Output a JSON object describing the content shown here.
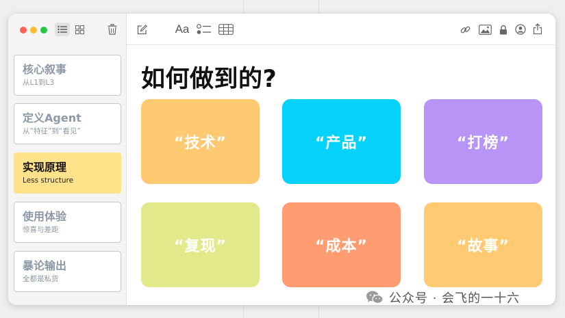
{
  "main": {
    "title": "如何做到的?",
    "cards": [
      {
        "label": "“技术”",
        "color": "#ffc972"
      },
      {
        "label": "“产品”",
        "color": "#04d2fb"
      },
      {
        "label": "“打榜”",
        "color": "#b794f6"
      },
      {
        "label": "“复现”",
        "color": "#e2e98a"
      },
      {
        "label": "“成本”",
        "color": "#ff9c72"
      },
      {
        "label": "“故事”",
        "color": "#ffca72"
      }
    ]
  },
  "sidebar": {
    "notes": [
      {
        "title": "核心叙事",
        "subtitle": "从L1到L3",
        "active": false
      },
      {
        "title": "定义Agent",
        "subtitle": "从“特征”到“看见”",
        "active": false
      },
      {
        "title": "实现原理",
        "subtitle": "Less structure",
        "active": true
      },
      {
        "title": "使用体验",
        "subtitle": "惊喜与差距",
        "active": false
      },
      {
        "title": "暴论输出",
        "subtitle": "全都是私货",
        "active": false
      }
    ]
  },
  "toolbar": {
    "font_label": "Aa",
    "icons": [
      "list-view-icon",
      "grid-view-icon",
      "trash-icon",
      "compose-icon",
      "format-icon",
      "checklist-icon",
      "table-icon",
      "link-icon",
      "image-icon",
      "lock-icon",
      "collaborate-icon",
      "share-icon"
    ]
  },
  "watermark": {
    "text": "公众号 · 会飞的一十六"
  },
  "colors": {
    "close": "#ff5f57",
    "minimize": "#febc2e",
    "zoom": "#28c840",
    "active_note": "#ffe28a",
    "wechat_icon": "#9a9a9a"
  }
}
